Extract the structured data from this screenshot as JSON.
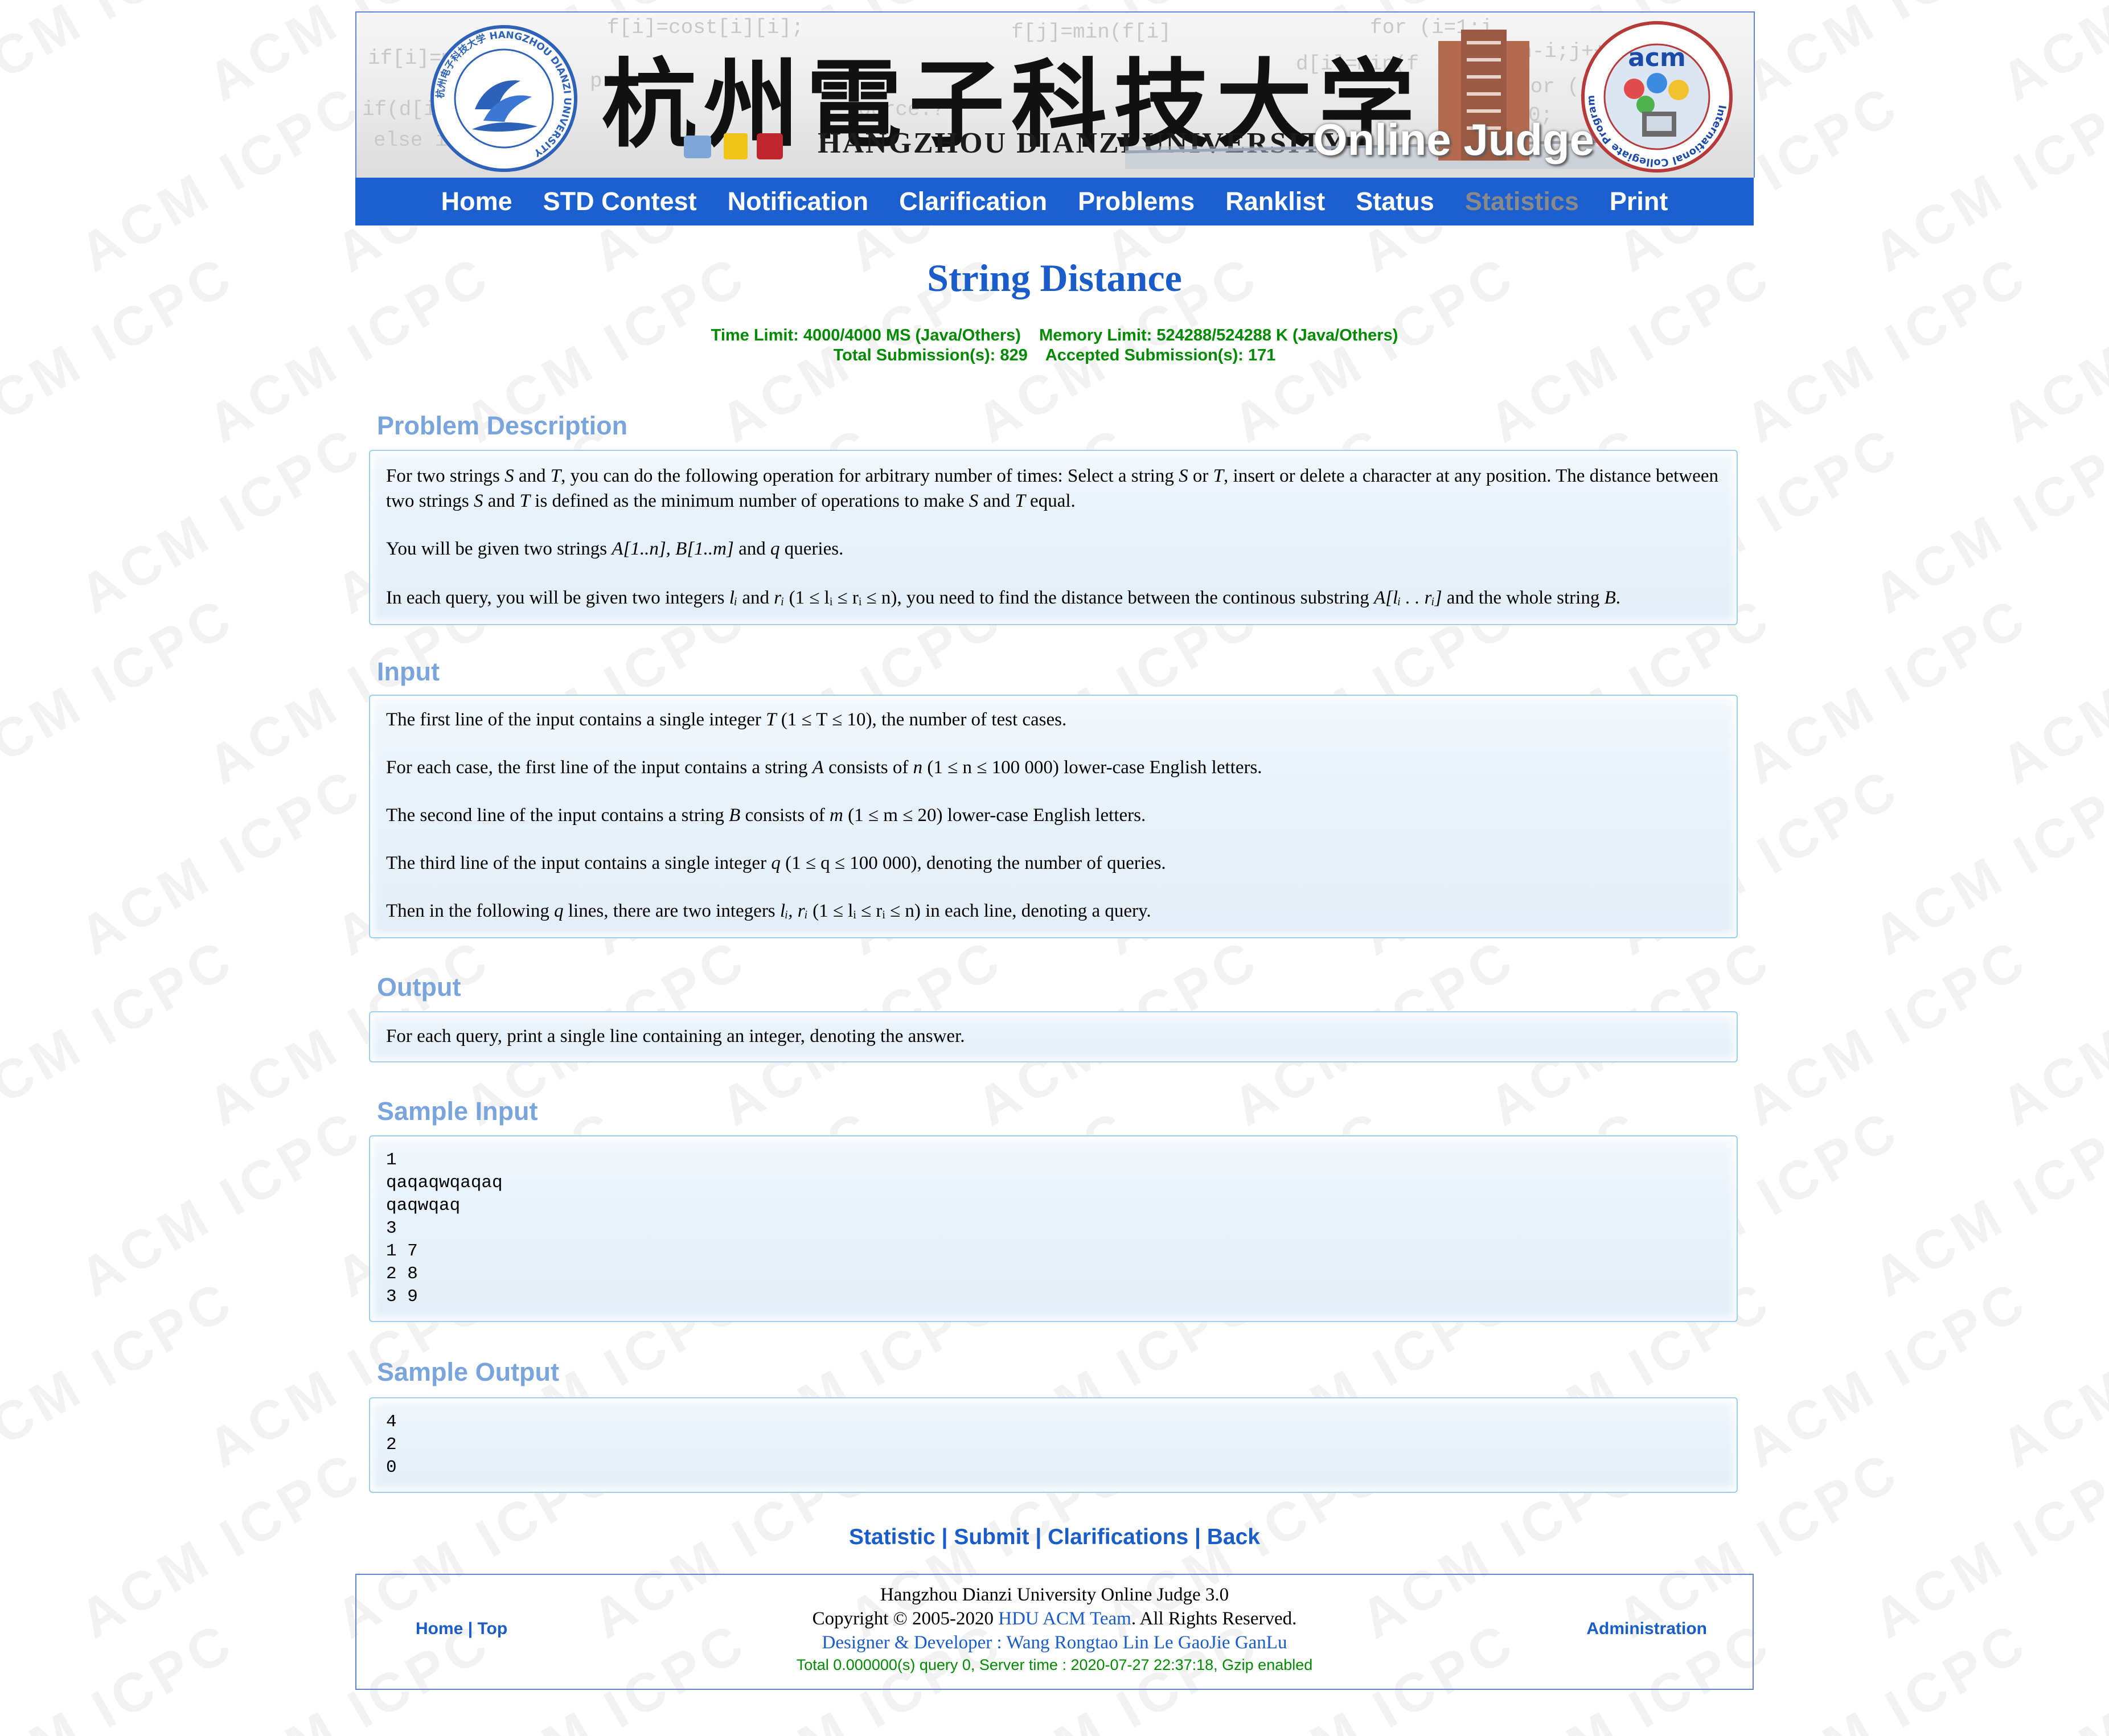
{
  "watermark": "ACM  ICPC",
  "banner": {
    "code_fragments": [
      "f[i]=cost[i][i];",
      "for (i=1;i",
      "i=n-i;j++) f",
      "if[i]=min(f[i],",
      "f[j]=min(f[i]",
      "if(d[i][j]",
      "else if (",
      "source:?",
      "pre",
      "for (j=0",
      "d[i]=min(f",
      "f[i]=0;"
    ],
    "logo_ring_text": "杭州电子科技大学 HANGZHOU DIANZI UNIVERSITY",
    "calligraphy": "杭州電子科技大学",
    "university_name": "HANGZHOU DIANZI UNIVERSITY",
    "oj_label": "Online Judge",
    "acm_logo_label": "acm",
    "acm_logo_ring": "International Collegiate Programming Contest"
  },
  "nav": [
    {
      "label": "Home"
    },
    {
      "label": "STD Contest"
    },
    {
      "label": "Notification"
    },
    {
      "label": "Clarification"
    },
    {
      "label": "Problems"
    },
    {
      "label": "Ranklist"
    },
    {
      "label": "Status"
    },
    {
      "label": "Statistics"
    },
    {
      "label": "Print"
    }
  ],
  "problem": {
    "title": "String Distance",
    "limits_line1": "Time Limit: 4000/4000 MS (Java/Others)    Memory Limit: 524288/524288 K (Java/Others)",
    "limits_line2": "Total Submission(s): 829    Accepted Submission(s): 171"
  },
  "sections": {
    "description_title": "Problem Description",
    "input_title": "Input",
    "output_title": "Output",
    "sample_input_title": "Sample Input",
    "sample_output_title": "Sample Output"
  },
  "description": {
    "p1": {
      "t1": "For two strings ",
      "S1": "S",
      "t2": " and ",
      "T1": "T",
      "t3": ", you can do the following operation for arbitrary number of times: Select a string ",
      "S2": "S",
      "t4": " or ",
      "T2": "T",
      "t5": ", insert or delete a character at any position. The distance between two strings ",
      "S3": "S",
      "t6": " and ",
      "T3": "T",
      "t7": " is defined as the minimum number of operations to make ",
      "S4": "S",
      "t8": " and ",
      "T4": "T",
      "t9": " equal."
    },
    "p2": {
      "t1": "You will be given two strings ",
      "math": "A[1..n], B[1..m]",
      "t2": " and ",
      "q": "q",
      "t3": " queries."
    },
    "p3": {
      "t1": "In each query, you will be given two integers ",
      "l": "lᵢ",
      "t2": " and ",
      "r": "rᵢ",
      "cond": " (1 ≤ lᵢ ≤ rᵢ ≤ n)",
      "t3": ", you need to find the distance between the continous substring ",
      "sub": "A[lᵢ . . rᵢ]",
      "t4": " and the whole string ",
      "B": "B",
      "t5": "."
    }
  },
  "input_spec": {
    "l1": {
      "t1": "The first line of the input contains a single integer ",
      "m1": "T",
      "m2": " (1 ≤ T ≤ 10)",
      "t2": ", the number of test cases."
    },
    "l2": {
      "t1": "For each case, the first line of the input contains a string ",
      "m1": "A",
      "t2": " consists of ",
      "m2": "n",
      "m3": " (1 ≤ n ≤ 100 000)",
      "t3": " lower-case English letters."
    },
    "l3": {
      "t1": "The second line of the input contains a string ",
      "m1": "B",
      "t2": " consists of ",
      "m2": "m",
      "m3": " (1 ≤ m ≤ 20)",
      "t3": " lower-case English letters."
    },
    "l4": {
      "t1": "The third line of the input contains a single integer ",
      "m1": "q",
      "m2": " (1 ≤ q ≤ 100 000)",
      "t2": ", denoting the number of queries."
    },
    "l5": {
      "t1": "Then in the following ",
      "m1": "q",
      "t2": " lines, there are two integers ",
      "m2": "lᵢ, rᵢ",
      "m3": " (1 ≤ lᵢ ≤ rᵢ ≤ n)",
      "t3": " in each line, denoting a query."
    }
  },
  "output_spec": "For each query, print a single line containing an integer, denoting the answer.",
  "sample_input": "1\nqaqaqwqaqaq\nqaqwqaq\n3\n1 7\n2 8\n3 9",
  "sample_output": "4\n2\n0",
  "bottom_links": {
    "statistic": "Statistic",
    "submit": "Submit",
    "clarifications": "Clarifications",
    "back": "Back",
    "sep": " | "
  },
  "footer": {
    "home": "Home",
    "sep": " | ",
    "top": "Top",
    "line1": "Hangzhou Dianzi University Online Judge 3.0",
    "copyright_pre": "Copyright © 2005-2020 ",
    "team": "HDU ACM Team",
    "copyright_post": ". All Rights Reserved.",
    "designer": "Designer & Developer : Wang Rongtao Lin Le GaoJie GanLu",
    "server": "Total 0.000000(s) query 0, Server time : 2020-07-27 22:37:18, Gzip enabled",
    "admin": "Administration"
  },
  "colors": {
    "nav_bg": "#1c5fcf",
    "title": "#1a5cc8",
    "section_title": "#7aa4dc",
    "limits": "#008a00",
    "panel_border": "#9ccfee",
    "current_nav": "#8a8a8a"
  }
}
